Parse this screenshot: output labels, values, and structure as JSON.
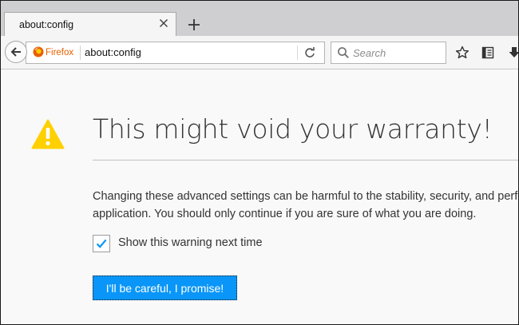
{
  "tabs": [
    {
      "title": "about:config"
    }
  ],
  "navbar": {
    "identity_label": "Firefox",
    "url": "about:config",
    "search_placeholder": "Search"
  },
  "icons": {
    "back": "back-arrow-icon",
    "firefox": "firefox-logo-icon",
    "reload": "reload-icon",
    "search": "search-icon",
    "bookmark": "star-icon",
    "library": "reading-list-icon",
    "downloads": "download-icon",
    "warning": "warning-triangle-icon"
  },
  "warning_page": {
    "title": "This might void your warranty!",
    "description_lines": [
      "Changing these advanced settings can be harmful to the stability, security, and performance of this",
      "application. You should only continue if you are sure of what you are doing."
    ],
    "checkbox_label": "Show this warning next time",
    "checkbox_checked": true,
    "accept_button": "I'll be careful, I promise!"
  },
  "colors": {
    "accent_button": "#0996f8",
    "warning_yellow": "#ffd000",
    "firefox_orange": "#e66000",
    "checkmark": "#0996f8"
  }
}
